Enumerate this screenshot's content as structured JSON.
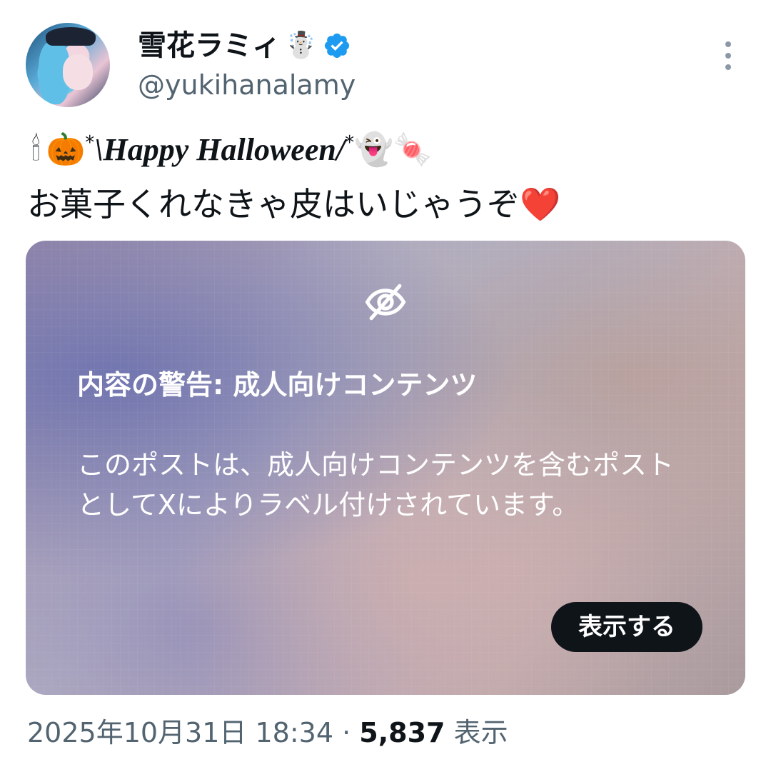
{
  "author": {
    "name": "雪花ラミィ",
    "name_emoji": "☃️",
    "handle": "@yukihanalamy",
    "verified_badge_color": "#1d9bf0",
    "avatar_icon": "avatar-image"
  },
  "menu": {
    "more_icon": "more-vertical-icon"
  },
  "post": {
    "line1": {
      "candle": "🕯",
      "pumpkin": "🎃",
      "star_left": "*",
      "slash_left": "\\",
      "greeting": "Happy Halloween",
      "slash_right": "/",
      "star_right": "*",
      "ghost": "👻",
      "candy": "🍬"
    },
    "line2_text": "お菓子くれなきゃ皮はいじゃうぞ",
    "line2_emoji": "❤️"
  },
  "media_warning": {
    "icon": "eye-slash-icon",
    "title": "内容の警告: 成人向けコンテンツ",
    "body": "このポストは、成人向けコンテンツを含むポストとしてXによりラベル付けされています。",
    "show_button": "表示する"
  },
  "meta": {
    "timestamp": "2025年10月31日 18:34",
    "separator": "·",
    "views_count": "5,837",
    "views_label": "表示"
  }
}
